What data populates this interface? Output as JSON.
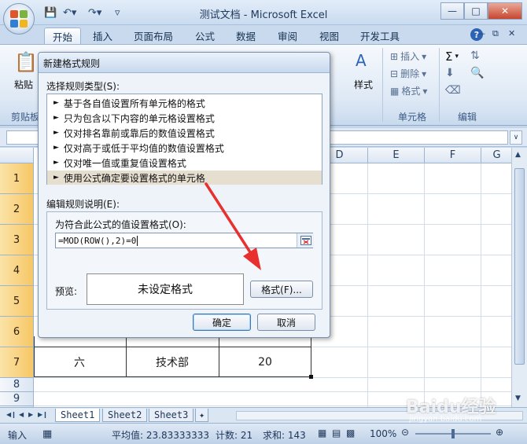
{
  "window": {
    "title": "测试文档 - Microsoft Excel"
  },
  "ribbon": {
    "tabs": [
      "开始",
      "插入",
      "页面布局",
      "公式",
      "数据",
      "审阅",
      "视图",
      "开发工具"
    ],
    "active_tab": "开始",
    "paste_label": "粘贴",
    "clipboard_label": "剪贴板",
    "styles_label": "样式",
    "cells_group": {
      "insert": "插入",
      "delete": "删除",
      "format": "格式",
      "label": "单元格"
    },
    "editing_group": {
      "label": "编辑",
      "sum_symbol": "Σ"
    }
  },
  "grid": {
    "columns": [
      "D",
      "E",
      "F",
      "G"
    ],
    "rows": [
      "1",
      "2",
      "3",
      "4",
      "5",
      "6",
      "7",
      "8",
      "9",
      "10"
    ],
    "row7": {
      "a": "六",
      "b": "技术部",
      "c": "20"
    }
  },
  "sheets": {
    "tabs": [
      "Sheet1",
      "Sheet2",
      "Sheet3"
    ],
    "active": "Sheet1"
  },
  "status": {
    "mode": "输入",
    "average": "平均值: 23.83333333",
    "count": "计数: 21",
    "sum": "求和: 143",
    "zoom": "100%"
  },
  "dialog": {
    "title": "新建格式规则",
    "rule_type_label": "选择规则类型(S):",
    "rule_types": [
      "基于各自值设置所有单元格的格式",
      "只为包含以下内容的单元格设置格式",
      "仅对排名靠前或靠后的数值设置格式",
      "仅对高于或低于平均值的数值设置格式",
      "仅对唯一值或重复值设置格式",
      "使用公式确定要设置格式的单元格"
    ],
    "selected_rule_index": 5,
    "edit_desc_label": "编辑规则说明(E):",
    "formula_label": "为符合此公式的值设置格式(O):",
    "formula_value": "=MOD(ROW(),2)=0",
    "preview_label": "预览:",
    "preview_text": "未设定格式",
    "format_button": "格式(F)...",
    "ok_button": "确定",
    "cancel_button": "取消"
  },
  "watermark": {
    "main": "Baidu经验",
    "sub": "jingyan.baidu.com"
  },
  "colors": {
    "accent": "#3b78b5",
    "annotation_arrow": "#e8312f",
    "selected_row_header": "#f6c766"
  }
}
